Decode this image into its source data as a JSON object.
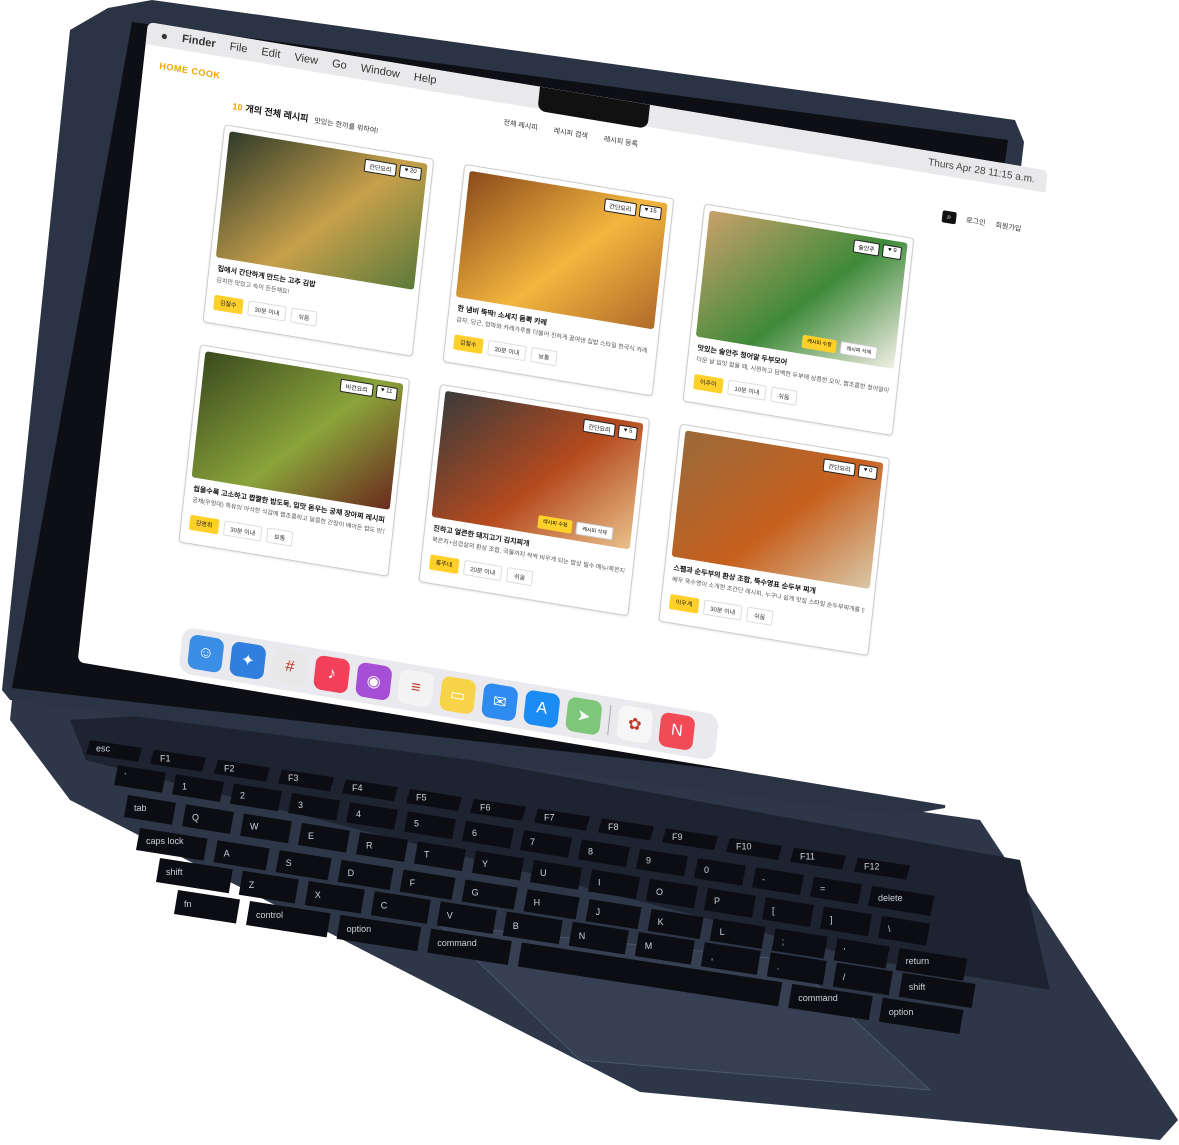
{
  "menubar": {
    "apple": "",
    "items": [
      "Finder",
      "File",
      "Edit",
      "View",
      "Go",
      "Window",
      "Help"
    ],
    "clock": "Thurs Apr 28 11:15 a.m."
  },
  "app": {
    "logo": "HOME COOK",
    "nav": [
      "전체 레시피",
      "레시피 검색",
      "레시피 등록"
    ],
    "auth": {
      "search_icon": "search-icon",
      "login": "로그인",
      "signup": "회원가입"
    },
    "headline": {
      "count": "10",
      "title": "개의 전체 레시피",
      "subtitle": "맛있는 한끼를 위하여!"
    }
  },
  "cards": [
    {
      "title": "집에서 간단하게 만드는 고추 김밥",
      "desc": "김치만 맛있고 속이 든든해요!",
      "author": "김철수",
      "time": "30분 이내",
      "level": "쉬움",
      "category": "간단요리",
      "likes": "20",
      "colors": [
        "#2f3b2a",
        "#c7a04b",
        "#5a7a3a"
      ]
    },
    {
      "title": "한 냄비 뚝딱! 소세지 듬뿍 카레",
      "desc": "감자, 당근, 양파와 카레가루를 더불어 진하게 끓여낸 집밥 스타일 한국식 카레 ...",
      "author": "김철수",
      "time": "30분 이내",
      "level": "보통",
      "category": "간단요리",
      "likes": "15",
      "colors": [
        "#8a4a1c",
        "#f3b63e",
        "#b06a2a"
      ]
    },
    {
      "title": "맛있는 술안주 청어알 두부모어",
      "desc": "더운 날 입맛 없을 때, 시원하고 담백한 두부에 상큼한 오이, 짭조름한 청어알이...",
      "author": "이주이",
      "time": "10분 이내",
      "level": "쉬움",
      "category": "술안주",
      "likes": "9",
      "colors": [
        "#c9a06a",
        "#3f8a3a",
        "#f2efe6"
      ],
      "edit": "레시피 수정",
      "delete": "레시피 삭제"
    },
    {
      "title": "씹을수록 고소하고 짭짤한 밥도둑, 입맛 돋우는 궁채 장아찌 레시피",
      "desc": "궁채(우엉대) 특유의 아삭한 식감에 짭조름하고 달콤한 간장이 배어든 밥도 반찬...",
      "author": "김영희",
      "time": "30분 이내",
      "level": "보통",
      "category": "비건요리",
      "likes": "11",
      "colors": [
        "#3a4a1e",
        "#8aa43a",
        "#6a2a1e"
      ]
    },
    {
      "title": "진하고 얼큰한 돼지고기 김치찌개",
      "desc": "묵은지+삼겹살의 환상 조합, 국물까지 싹싹 비우게 되는 밥상 필수 메뉴!묵은지...",
      "author": "홍주네",
      "time": "20분 이내",
      "level": "쉬움",
      "category": "간단요리",
      "likes": "5",
      "colors": [
        "#3b3b3b",
        "#b54a1e",
        "#e8c08a"
      ],
      "edit": "레시피 수정",
      "delete": "레시피 삭제"
    },
    {
      "title": "스팸과 순두부의 환상 조합, 뚝수영표 순두부 찌개",
      "desc": "배우 뚝수영이 소개한 초간단 레시피, 누구나 쉽게 맛집 스타일 순두부찌개를 만...",
      "author": "이우게",
      "time": "30분 이내",
      "level": "쉬움",
      "category": "간단요리",
      "likes": "0",
      "colors": [
        "#9a6a3a",
        "#c7601e",
        "#d9c7a6"
      ]
    }
  ],
  "dock": [
    "finder-icon",
    "safari-icon",
    "slack-icon",
    "music-icon",
    "podcasts-icon",
    "reminders-icon",
    "notes-icon",
    "mail-icon",
    "app-store-icon",
    "maps-icon",
    "photos-icon",
    "news-icon"
  ],
  "keyboard": {
    "rows": [
      [
        "esc",
        "F1",
        "F2",
        "F3",
        "F4",
        "F5",
        "F6",
        "F7",
        "F8",
        "F9",
        "F10",
        "F11",
        "F12"
      ],
      [
        "`",
        "1",
        "2",
        "3",
        "4",
        "5",
        "6",
        "7",
        "8",
        "9",
        "0",
        "-",
        "=",
        "delete"
      ],
      [
        "tab",
        "Q",
        "W",
        "E",
        "R",
        "T",
        "Y",
        "U",
        "I",
        "O",
        "P",
        "[",
        "]",
        "\\"
      ],
      [
        "caps lock",
        "A",
        "S",
        "D",
        "F",
        "G",
        "H",
        "J",
        "K",
        "L",
        ";",
        "'",
        "return"
      ],
      [
        "shift",
        "Z",
        "X",
        "C",
        "V",
        "B",
        "N",
        "M",
        ",",
        ".",
        "/",
        "shift"
      ],
      [
        "fn",
        "control",
        "option",
        "command",
        " ",
        "command",
        "option"
      ]
    ]
  },
  "colors": {
    "laptop": "#2b3444",
    "accent": "#f0a500",
    "yellow": "#ffd02a"
  }
}
